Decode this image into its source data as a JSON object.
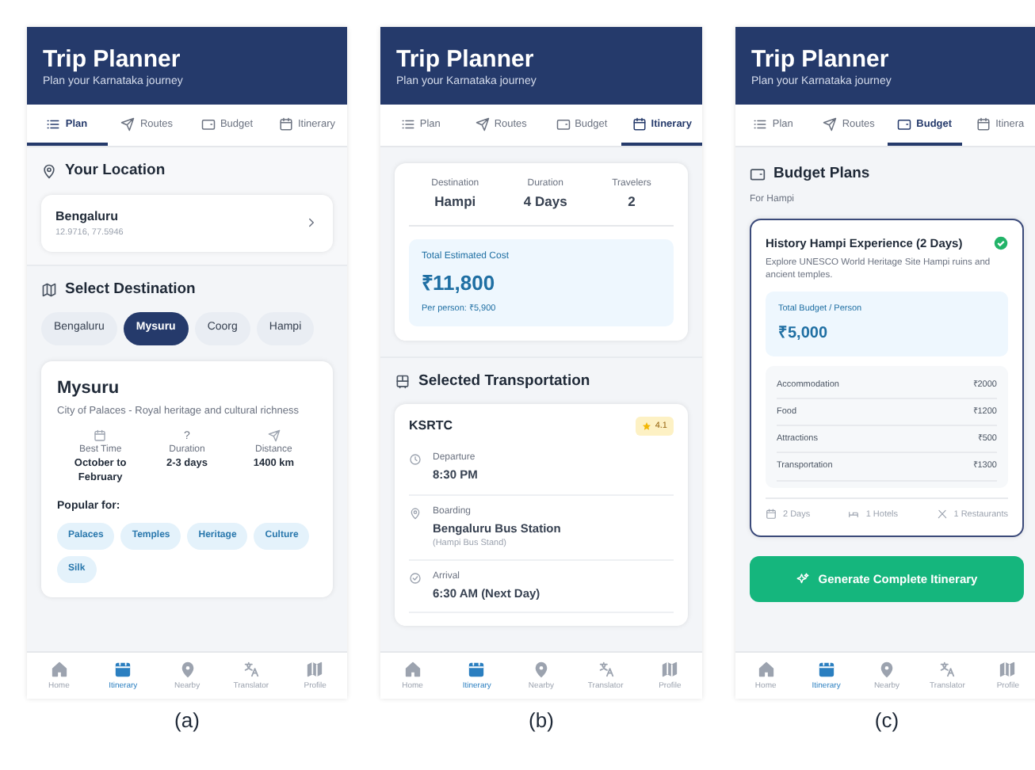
{
  "panels": [
    {
      "caption": "(a)",
      "title": "Trip Planner",
      "subtitle": "Plan your Karnataka journey",
      "kind": "plan",
      "tabs": [
        {
          "label": "Plan",
          "selected": true
        },
        {
          "label": "Routes",
          "selected": false
        },
        {
          "label": "Budget",
          "selected": false
        },
        {
          "label": "Itinerary",
          "selected": false
        }
      ],
      "location": {
        "heading": "Your Location",
        "name": "Bengaluru",
        "coords": "12.9716, 77.5946"
      },
      "destination": {
        "heading": "Select Destination",
        "options": [
          {
            "label": "Bengaluru",
            "selected": false
          },
          {
            "label": "Mysuru",
            "selected": true
          },
          {
            "label": "Coorg",
            "selected": false
          },
          {
            "label": "Hampi",
            "selected": false
          }
        ],
        "detail": {
          "name": "Mysuru",
          "description": "City of Palaces - Royal heritage and cultural richness",
          "stats": [
            {
              "label": "Best Time",
              "value": "October to February"
            },
            {
              "symbol": "?",
              "label": "Duration",
              "value": "2-3 days"
            },
            {
              "label": "Distance",
              "value": "1400 km"
            }
          ],
          "popular_label": "Popular for:",
          "tags": [
            "Palaces",
            "Temples",
            "Heritage",
            "Culture",
            "Silk"
          ]
        }
      },
      "bottom_nav": [
        {
          "label": "Home",
          "selected": false
        },
        {
          "label": "Itinerary",
          "selected": true
        },
        {
          "label": "Nearby",
          "selected": false
        },
        {
          "label": "Translator",
          "selected": false
        },
        {
          "label": "Profile",
          "selected": false
        }
      ]
    },
    {
      "caption": "(b)",
      "title": "Trip Planner",
      "subtitle": "Plan your Karnataka journey",
      "kind": "itinerary",
      "tabs": [
        {
          "label": "Plan",
          "selected": false
        },
        {
          "label": "Routes",
          "selected": false
        },
        {
          "label": "Budget",
          "selected": false
        },
        {
          "label": "Itinerary",
          "selected": true
        }
      ],
      "summary": [
        {
          "label": "Destination",
          "value": "Hampi"
        },
        {
          "label": "Duration",
          "value": "4 Days"
        },
        {
          "label": "Travelers",
          "value": "2"
        }
      ],
      "cost": {
        "label": "Total Estimated Cost",
        "amount": "₹11,800",
        "per_person": "Per person: ₹5,900"
      },
      "transport": {
        "heading": "Selected Transportation",
        "operator": "KSRTC",
        "rating": "4.1",
        "stops": [
          {
            "label": "Departure",
            "value": "8:30 PM"
          },
          {
            "label": "Boarding",
            "value": "Bengaluru Bus Station",
            "note": "(Hampi Bus Stand)"
          },
          {
            "label": "Arrival",
            "value": "6:30 AM (Next Day)"
          }
        ]
      },
      "bottom_nav": [
        {
          "label": "Home",
          "selected": false
        },
        {
          "label": "Itinerary",
          "selected": true
        },
        {
          "label": "Nearby",
          "selected": false
        },
        {
          "label": "Translator",
          "selected": false
        },
        {
          "label": "Profile",
          "selected": false
        }
      ]
    },
    {
      "caption": "(c)",
      "title": "Trip Planner",
      "subtitle": "Plan your Karnataka journey",
      "kind": "budget",
      "tabs": [
        {
          "label": "Plan",
          "selected": false
        },
        {
          "label": "Routes",
          "selected": false
        },
        {
          "label": "Budget",
          "selected": true
        },
        {
          "label": "Itinera",
          "selected": false
        }
      ],
      "budget": {
        "heading": "Budget Plans",
        "subheading": "For Hampi",
        "plan": {
          "title": "History Hampi Experience (2 Days)",
          "selected": true,
          "description": "Explore UNESCO World Heritage Site Hampi ruins and ancient temples.",
          "total_label": "Total Budget / Person",
          "total": "₹5,000",
          "breakdown": [
            {
              "item": "Accommodation",
              "amount": "₹2000"
            },
            {
              "item": "Food",
              "amount": "₹1200"
            },
            {
              "item": "Attractions",
              "amount": "₹500"
            },
            {
              "item": "Transportation",
              "amount": "₹1300"
            }
          ],
          "facts": [
            "2 Days",
            "1 Hotels",
            "1 Restaurants"
          ]
        },
        "button": "Generate Complete Itinerary"
      },
      "bottom_nav": [
        {
          "label": "Home",
          "selected": false
        },
        {
          "label": "Itinerary",
          "selected": true
        },
        {
          "label": "Nearby",
          "selected": false
        },
        {
          "label": "Translator",
          "selected": false
        },
        {
          "label": "Profile",
          "selected": false
        }
      ]
    }
  ]
}
